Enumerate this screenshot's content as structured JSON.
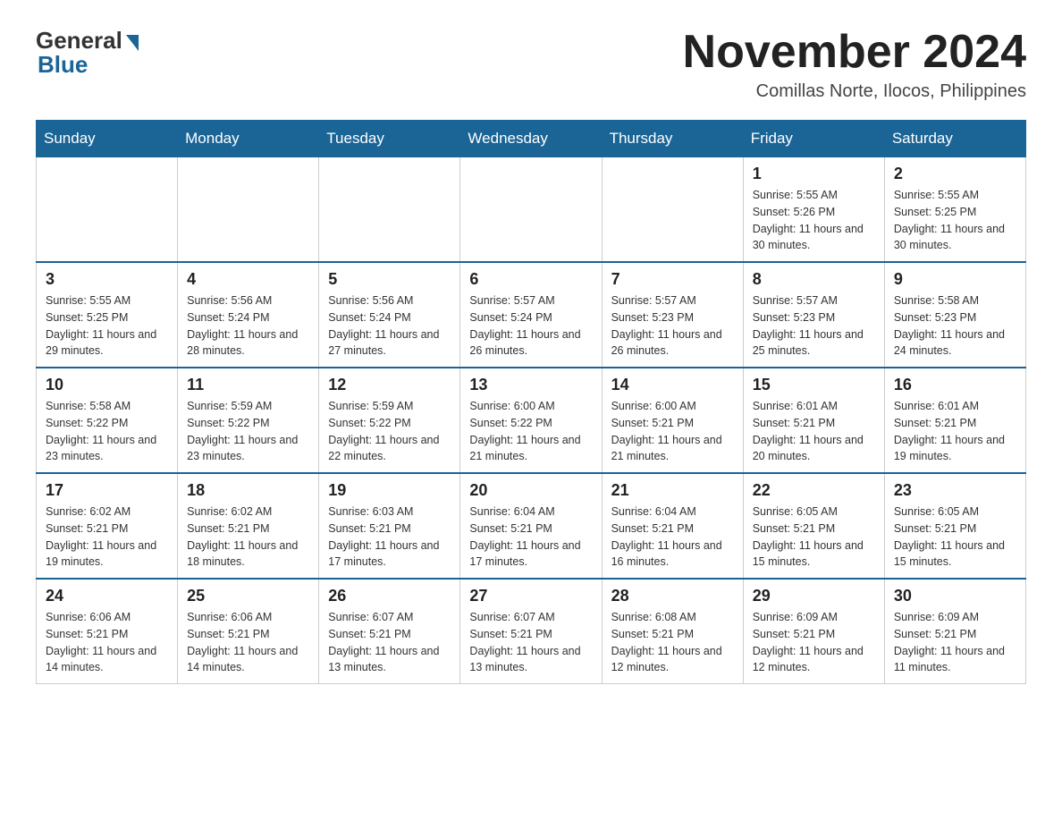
{
  "header": {
    "logo_general": "General",
    "logo_blue": "Blue",
    "month_year": "November 2024",
    "location": "Comillas Norte, Ilocos, Philippines"
  },
  "days_of_week": [
    "Sunday",
    "Monday",
    "Tuesday",
    "Wednesday",
    "Thursday",
    "Friday",
    "Saturday"
  ],
  "weeks": [
    [
      {
        "day": "",
        "info": ""
      },
      {
        "day": "",
        "info": ""
      },
      {
        "day": "",
        "info": ""
      },
      {
        "day": "",
        "info": ""
      },
      {
        "day": "",
        "info": ""
      },
      {
        "day": "1",
        "info": "Sunrise: 5:55 AM\nSunset: 5:26 PM\nDaylight: 11 hours and 30 minutes."
      },
      {
        "day": "2",
        "info": "Sunrise: 5:55 AM\nSunset: 5:25 PM\nDaylight: 11 hours and 30 minutes."
      }
    ],
    [
      {
        "day": "3",
        "info": "Sunrise: 5:55 AM\nSunset: 5:25 PM\nDaylight: 11 hours and 29 minutes."
      },
      {
        "day": "4",
        "info": "Sunrise: 5:56 AM\nSunset: 5:24 PM\nDaylight: 11 hours and 28 minutes."
      },
      {
        "day": "5",
        "info": "Sunrise: 5:56 AM\nSunset: 5:24 PM\nDaylight: 11 hours and 27 minutes."
      },
      {
        "day": "6",
        "info": "Sunrise: 5:57 AM\nSunset: 5:24 PM\nDaylight: 11 hours and 26 minutes."
      },
      {
        "day": "7",
        "info": "Sunrise: 5:57 AM\nSunset: 5:23 PM\nDaylight: 11 hours and 26 minutes."
      },
      {
        "day": "8",
        "info": "Sunrise: 5:57 AM\nSunset: 5:23 PM\nDaylight: 11 hours and 25 minutes."
      },
      {
        "day": "9",
        "info": "Sunrise: 5:58 AM\nSunset: 5:23 PM\nDaylight: 11 hours and 24 minutes."
      }
    ],
    [
      {
        "day": "10",
        "info": "Sunrise: 5:58 AM\nSunset: 5:22 PM\nDaylight: 11 hours and 23 minutes."
      },
      {
        "day": "11",
        "info": "Sunrise: 5:59 AM\nSunset: 5:22 PM\nDaylight: 11 hours and 23 minutes."
      },
      {
        "day": "12",
        "info": "Sunrise: 5:59 AM\nSunset: 5:22 PM\nDaylight: 11 hours and 22 minutes."
      },
      {
        "day": "13",
        "info": "Sunrise: 6:00 AM\nSunset: 5:22 PM\nDaylight: 11 hours and 21 minutes."
      },
      {
        "day": "14",
        "info": "Sunrise: 6:00 AM\nSunset: 5:21 PM\nDaylight: 11 hours and 21 minutes."
      },
      {
        "day": "15",
        "info": "Sunrise: 6:01 AM\nSunset: 5:21 PM\nDaylight: 11 hours and 20 minutes."
      },
      {
        "day": "16",
        "info": "Sunrise: 6:01 AM\nSunset: 5:21 PM\nDaylight: 11 hours and 19 minutes."
      }
    ],
    [
      {
        "day": "17",
        "info": "Sunrise: 6:02 AM\nSunset: 5:21 PM\nDaylight: 11 hours and 19 minutes."
      },
      {
        "day": "18",
        "info": "Sunrise: 6:02 AM\nSunset: 5:21 PM\nDaylight: 11 hours and 18 minutes."
      },
      {
        "day": "19",
        "info": "Sunrise: 6:03 AM\nSunset: 5:21 PM\nDaylight: 11 hours and 17 minutes."
      },
      {
        "day": "20",
        "info": "Sunrise: 6:04 AM\nSunset: 5:21 PM\nDaylight: 11 hours and 17 minutes."
      },
      {
        "day": "21",
        "info": "Sunrise: 6:04 AM\nSunset: 5:21 PM\nDaylight: 11 hours and 16 minutes."
      },
      {
        "day": "22",
        "info": "Sunrise: 6:05 AM\nSunset: 5:21 PM\nDaylight: 11 hours and 15 minutes."
      },
      {
        "day": "23",
        "info": "Sunrise: 6:05 AM\nSunset: 5:21 PM\nDaylight: 11 hours and 15 minutes."
      }
    ],
    [
      {
        "day": "24",
        "info": "Sunrise: 6:06 AM\nSunset: 5:21 PM\nDaylight: 11 hours and 14 minutes."
      },
      {
        "day": "25",
        "info": "Sunrise: 6:06 AM\nSunset: 5:21 PM\nDaylight: 11 hours and 14 minutes."
      },
      {
        "day": "26",
        "info": "Sunrise: 6:07 AM\nSunset: 5:21 PM\nDaylight: 11 hours and 13 minutes."
      },
      {
        "day": "27",
        "info": "Sunrise: 6:07 AM\nSunset: 5:21 PM\nDaylight: 11 hours and 13 minutes."
      },
      {
        "day": "28",
        "info": "Sunrise: 6:08 AM\nSunset: 5:21 PM\nDaylight: 11 hours and 12 minutes."
      },
      {
        "day": "29",
        "info": "Sunrise: 6:09 AM\nSunset: 5:21 PM\nDaylight: 11 hours and 12 minutes."
      },
      {
        "day": "30",
        "info": "Sunrise: 6:09 AM\nSunset: 5:21 PM\nDaylight: 11 hours and 11 minutes."
      }
    ]
  ]
}
